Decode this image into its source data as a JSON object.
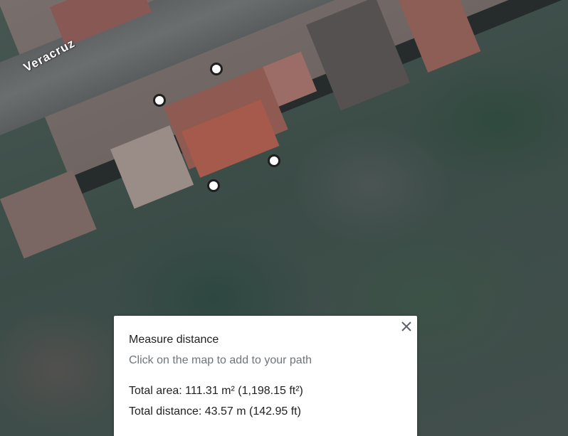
{
  "map": {
    "street_label": "Veracruz"
  },
  "measure_panel": {
    "title": "Measure distance",
    "hint": "Click on the map to add to your path",
    "total_area": "Total area: 111.31 m² (1,198.15 ft²)",
    "total_distance": "Total distance: 43.57 m (142.95 ft)",
    "close_icon": "close-icon"
  },
  "colors": {
    "panel_text": "#212121",
    "panel_hint": "#70757a",
    "point_border": "#1f1f1f"
  }
}
